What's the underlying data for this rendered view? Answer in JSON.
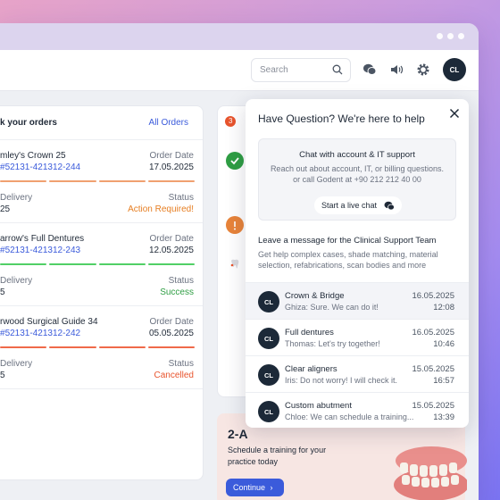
{
  "topbar": {
    "search_placeholder": "Search",
    "avatar_initials": "CL"
  },
  "orders": {
    "title": "k your orders",
    "all_orders_label": "All Orders",
    "date_label": "Order Date",
    "delivery_label": "Delivery",
    "status_label": "Status",
    "items": [
      {
        "name": "mley's Crown 25",
        "id": "52131-421312-244",
        "date": "17.05.2025",
        "delivery": "25",
        "status": "Action Required!",
        "status_color": "#e67e22",
        "bar_color": "#f0a070"
      },
      {
        "name": "arrow's Full Dentures",
        "id": "52131-421312-243",
        "date": "12.05.2025",
        "delivery": "5",
        "status": "Success",
        "status_color": "#2f9e44",
        "bar_color": "#51cf66"
      },
      {
        "name": "rwood Surgical Guide 34",
        "id": "52131-421312-242",
        "date": "05.05.2025",
        "delivery": "5",
        "status": "Cancelled",
        "status_color": "#e8542d",
        "bar_color": "#f06a4a"
      }
    ]
  },
  "notifications": {
    "badge": "3"
  },
  "promo": {
    "title": "2-A",
    "text": "Schedule a training for your practice today",
    "button_label": "Continue"
  },
  "help": {
    "title": "Have Question? We're here to help",
    "box_title": "Chat with account & IT support",
    "box_text": "Reach out about account, IT, or billing questions. or call Godent at +90 212 212 40 00",
    "live_chat_label": "Start a live chat",
    "leave_title": "Leave a message for the Clinical Support Team",
    "leave_text": "Get help complex cases, shade matching, material selection, refabrications, scan bodies and more",
    "messages": [
      {
        "initials": "CL",
        "name": "Crown & Bridge",
        "text": "Ghiza: Sure. We can do it!",
        "date": "16.05.2025",
        "time": "12:08"
      },
      {
        "initials": "CL",
        "name": "Full dentures",
        "text": "Thomas: Let's try together!",
        "date": "16.05.2025",
        "time": "10:46"
      },
      {
        "initials": "CL",
        "name": "Clear aligners",
        "text": "Iris: Do not worry! I will check it.",
        "date": "15.05.2025",
        "time": "16:57"
      },
      {
        "initials": "CL",
        "name": "Custom abutment",
        "text": "Chloe: We can schedule a training...",
        "date": "15.05.2025",
        "time": "13:39"
      }
    ]
  }
}
